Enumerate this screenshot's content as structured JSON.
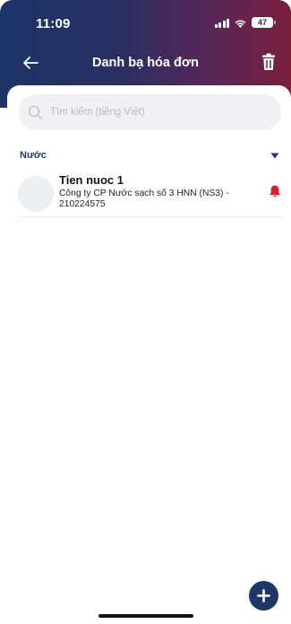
{
  "status_bar": {
    "time": "11:09",
    "battery": "47",
    "icons": [
      "signal-icon",
      "wifi-icon",
      "battery-icon"
    ]
  },
  "nav": {
    "title": "Danh bạ hóa đơn",
    "back_icon": "arrow-left-icon",
    "delete_icon": "trash-icon"
  },
  "search": {
    "placeholder": "Tìm kiếm (tiếng Việt)",
    "value": ""
  },
  "section": {
    "title": "Nước",
    "expanded_icon": "chevron-down-icon"
  },
  "bills": [
    {
      "name": "Tien nuoc 1",
      "description": "Công ty CP Nước sạch số 3 HNN (NS3) - 210224575",
      "alert_icon": "bell-icon"
    }
  ],
  "fab": {
    "icon": "plus-icon"
  },
  "colors": {
    "header_gradient_start": "#1c3466",
    "header_gradient_end": "#7a1e3c",
    "accent": "#1e3766",
    "section_title": "#1f3b73",
    "alert": "#e01e2b",
    "search_bg": "#f1f1f3"
  }
}
